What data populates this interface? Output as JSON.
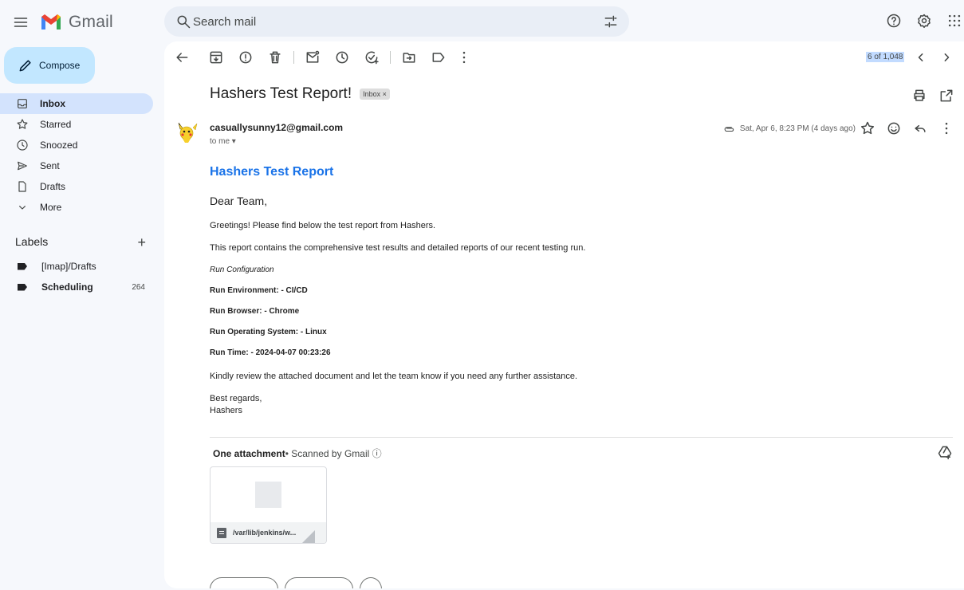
{
  "app": {
    "name": "Gmail"
  },
  "search": {
    "placeholder": "Search mail"
  },
  "sidebar": {
    "compose_label": "Compose",
    "items": [
      {
        "label": "Inbox",
        "icon": "inbox-icon",
        "active": true
      },
      {
        "label": "Starred",
        "icon": "star-icon"
      },
      {
        "label": "Snoozed",
        "icon": "clock-icon"
      },
      {
        "label": "Sent",
        "icon": "send-icon"
      },
      {
        "label": "Drafts",
        "icon": "draft-icon"
      },
      {
        "label": "More",
        "icon": "chevron-down-icon"
      }
    ],
    "labels_heading": "Labels",
    "labels": [
      {
        "label": "[Imap]/Drafts",
        "count": ""
      },
      {
        "label": "Scheduling",
        "count": "264"
      }
    ]
  },
  "toolbar": {
    "pager": "6 of 1,048"
  },
  "email": {
    "subject": "Hashers Test Report!",
    "folder_chip": "Inbox ×",
    "sender": "casuallysunny12@gmail.com",
    "to": "to me ▾",
    "date": "Sat, Apr 6, 8:23 PM (4 days ago)",
    "body": {
      "title": "Hashers Test Report",
      "greeting": "Dear Team,",
      "line1": "Greetings! Please find below the test report from Hashers.",
      "line2": "This report contains the comprehensive test results and detailed reports of our recent testing run.",
      "config_heading": "Run Configuration",
      "env": "Run Environment: - CI/CD",
      "browser": "Run Browser: - Chrome",
      "os": "Run Operating System: - Linux",
      "time": "Run Time: - 2024-04-07 00:23:26",
      "review": "Kindly review the attached document and let the team know if you need any further assistance.",
      "signoff1": "Best regards,",
      "signoff2": "Hashers"
    },
    "attachments": {
      "heading": "One attachment",
      "scanned": " • Scanned by Gmail ⓘ",
      "file_name": "/var/lib/jenkins/w..."
    }
  },
  "colors": {
    "accent": "#1a73e8",
    "compose_bg": "#c2e7ff",
    "active_nav": "#d3e3fd"
  }
}
